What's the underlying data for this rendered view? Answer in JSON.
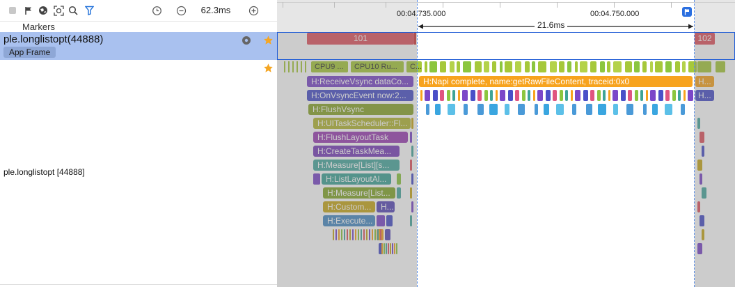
{
  "toolbar": {
    "icons": [
      "square-icon",
      "flag-icon",
      "globe-icon",
      "capture-icon",
      "search-icon",
      "filter-icon"
    ],
    "zoom_value": "62.3ms"
  },
  "tracks_header": {
    "markers_label": "Markers"
  },
  "process_track": {
    "title": "ple.longlistopt(44888)",
    "badge": "App Frame"
  },
  "thread_track": {
    "title": "ple.longlistopt [44888]"
  },
  "timeline": {
    "tick_left": "00:04.735.000",
    "tick_right": "00:04.750.000",
    "range_duration": "21.6ms"
  },
  "frames": [
    {
      "label": "101",
      "color": "#e0555f"
    },
    {
      "label": "102",
      "color": "#e0555f"
    }
  ],
  "cpu_labels": [
    "CPU9 ...",
    "CPU10 Ru...",
    "C..."
  ],
  "slices": [
    {
      "label": "H:ReceiveVsync dataCo...",
      "color": "#7b47c9"
    },
    {
      "label": "H:OnVsyncEvent now:2...",
      "color": "#4a50c8"
    },
    {
      "label": "H:FlushVsync",
      "color": "#8aa52a"
    },
    {
      "label": "H:UITaskScheduler::Fl...",
      "color": "#b3b635"
    },
    {
      "label": "H:FlushLayoutTask",
      "color": "#9b3fb4"
    },
    {
      "label": "H:CreateTaskMea...",
      "color": "#7a3fba"
    },
    {
      "label": "H:Measure[List][s...",
      "color": "#4aa99f"
    },
    {
      "label": "H:ListLayoutAl...",
      "color": "#3ea497"
    },
    {
      "label": "H:Measure[List...",
      "color": "#83a629"
    },
    {
      "label": "H:Custom...",
      "color": "#c9a81a"
    },
    {
      "label": "H...",
      "color": "#5a4ab8"
    },
    {
      "label": "H:Execute...",
      "color": "#4a8cc4"
    }
  ],
  "napi_slice": {
    "label": "H:Napi complete, name:getRawFileContent, traceid:0x0",
    "color": "#f7a31e"
  },
  "right_slices": [
    "H...",
    "H..."
  ],
  "colors": {
    "accent": "#1e5bd6",
    "selection_bg": "#a9c1ef",
    "star": "#f5a623"
  }
}
